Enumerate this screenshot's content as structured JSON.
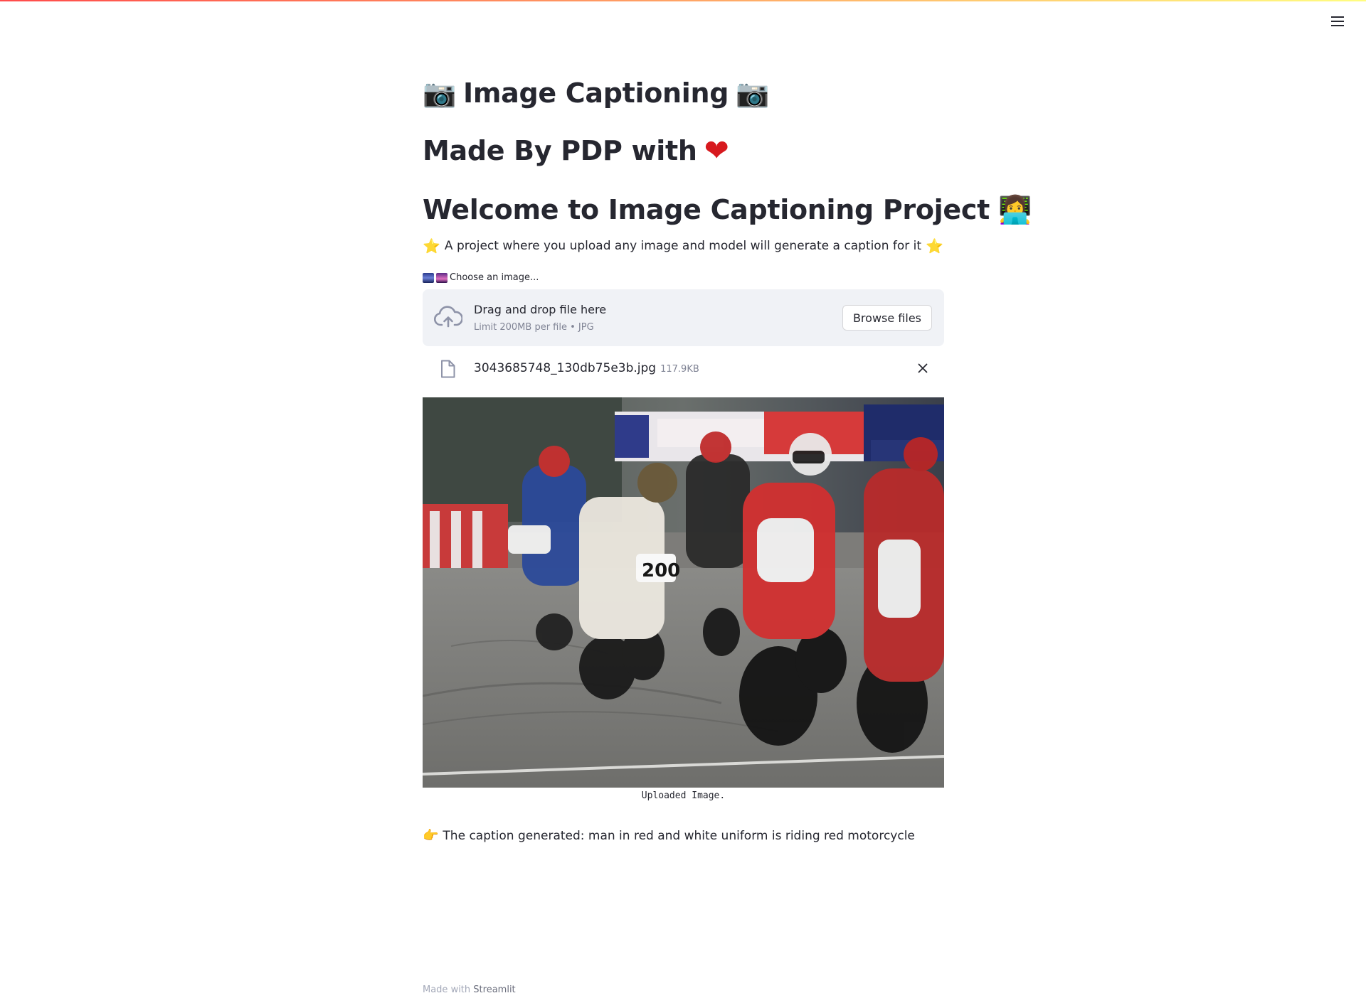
{
  "header": {
    "menu_icon": "hamburger-menu-icon"
  },
  "title": {
    "text": "Image Captioning",
    "icon_left": "📷",
    "icon_right": "📷"
  },
  "subtitle": {
    "text": "Made By PDP with",
    "icon": "❤"
  },
  "welcome": {
    "text": "Welcome to Image Captioning Project",
    "icon": "👩‍💻"
  },
  "description": {
    "text": "A project where you upload any image and model will generate a caption for it",
    "icon": "⭐"
  },
  "uploader": {
    "label": "Choose an image...",
    "dropzone_title": "Drag and drop file here",
    "dropzone_hint": "Limit 200MB per file • JPG",
    "browse_label": "Browse files"
  },
  "uploaded_file": {
    "name": "3043685748_130db75e3b.jpg",
    "size": "117.9KB"
  },
  "image": {
    "caption": "Uploaded Image."
  },
  "result": {
    "icon": "👉",
    "text": "The caption generated: man in red and white uniform is riding red motorcycle"
  },
  "footer": {
    "prefix": "Made with",
    "link": "Streamlit"
  },
  "colors": {
    "accent": "#ff4b4b",
    "text": "#262730",
    "muted": "#808495",
    "dropzone_bg": "#f0f2f6"
  }
}
